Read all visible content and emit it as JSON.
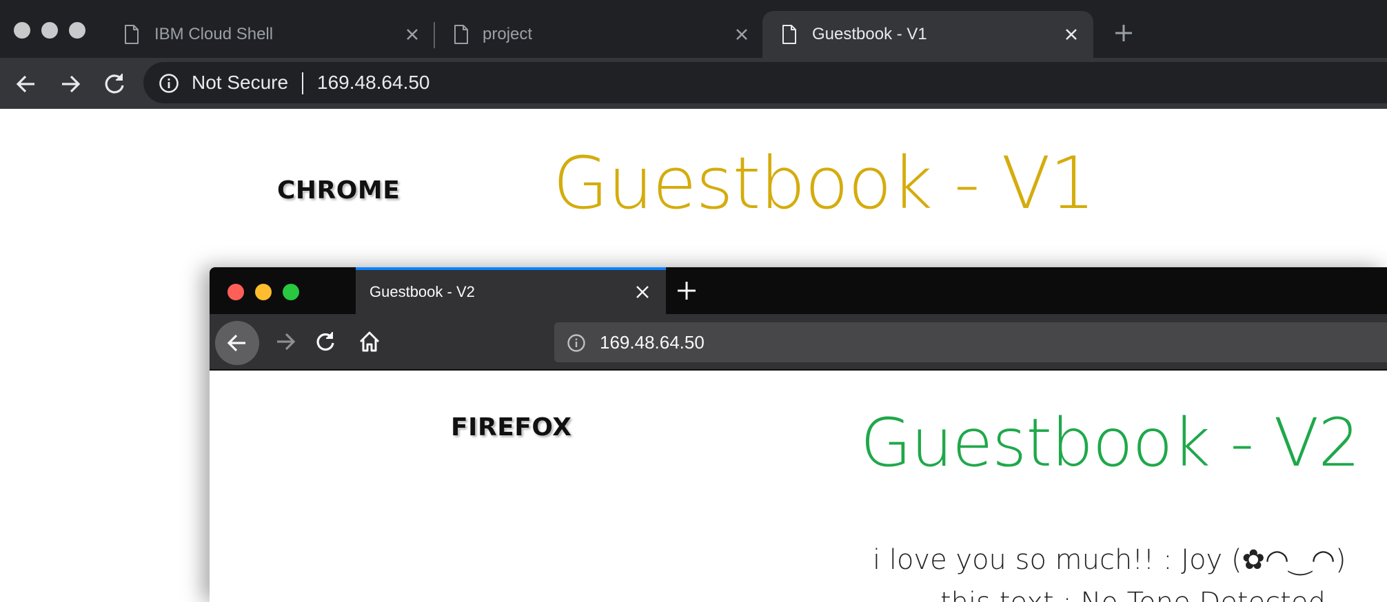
{
  "chrome": {
    "tabs": [
      {
        "title": "IBM Cloud Shell",
        "active": false
      },
      {
        "title": "project",
        "active": false
      },
      {
        "title": "Guestbook - V1",
        "active": true
      }
    ],
    "omnibox": {
      "security_label": "Not Secure",
      "url": "169.48.64.50"
    },
    "colors": {
      "tabbar": "#202124",
      "toolbar": "#35363a"
    }
  },
  "page_v1": {
    "browser_label": "CHROME",
    "title": "Guestbook - V1",
    "title_color": "#d4ac0d"
  },
  "firefox": {
    "tab": {
      "title": "Guestbook - V2"
    },
    "urlbar": {
      "url": "169.48.64.50"
    },
    "colors": {
      "close": "#ff5f57",
      "minimize": "#febc2e",
      "zoom": "#28c840",
      "tab_accent": "#0a84ff"
    }
  },
  "page_v2": {
    "browser_label": "FIREFOX",
    "title": "Guestbook - V2",
    "title_color": "#1fa84a",
    "entries": [
      "i love you so much!! : Joy (✿◠‿◠)",
      "this text : No Tone Detected"
    ]
  }
}
